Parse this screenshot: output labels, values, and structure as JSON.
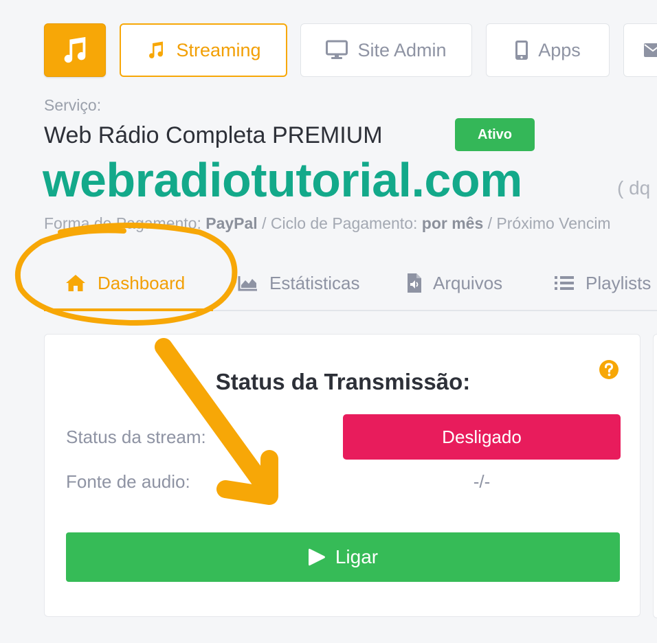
{
  "top_nav": {
    "streaming_label": "Streaming",
    "site_admin_label": "Site Admin",
    "apps_label": "Apps"
  },
  "service": {
    "label": "Serviço:",
    "plan_name": "Web Rádio Completa PREMIUM",
    "status_badge": "Ativo",
    "domain": "webradiotutorial.com",
    "domain_extra": "( dq",
    "payment_method_label": "Forma de Pagamento:",
    "payment_method": "PayPal",
    "cycle_label": "/ Ciclo de Pagamento:",
    "cycle": "por mês",
    "next_due_label": "/ Próximo Vencim"
  },
  "tabs": [
    {
      "label": "Dashboard",
      "icon": "home-icon",
      "active": true
    },
    {
      "label": "Estátisticas",
      "icon": "area-chart-icon",
      "active": false
    },
    {
      "label": "Arquivos",
      "icon": "audio-file-icon",
      "active": false
    },
    {
      "label": "Playlists",
      "icon": "list-icon",
      "active": false
    }
  ],
  "transmission": {
    "title": "Status da Transmissão:",
    "stream_status_label": "Status da stream:",
    "stream_status_value": "Desligado",
    "audio_source_label": "Fonte de audio:",
    "audio_source_value": "-/-",
    "start_button_label": "Ligar"
  },
  "colors": {
    "accent": "#f7a707",
    "domain": "#13a98a",
    "active_badge": "#34b758",
    "off_status": "#e81c5c",
    "start_button": "#36bb57",
    "annotation": "#f7a707"
  }
}
